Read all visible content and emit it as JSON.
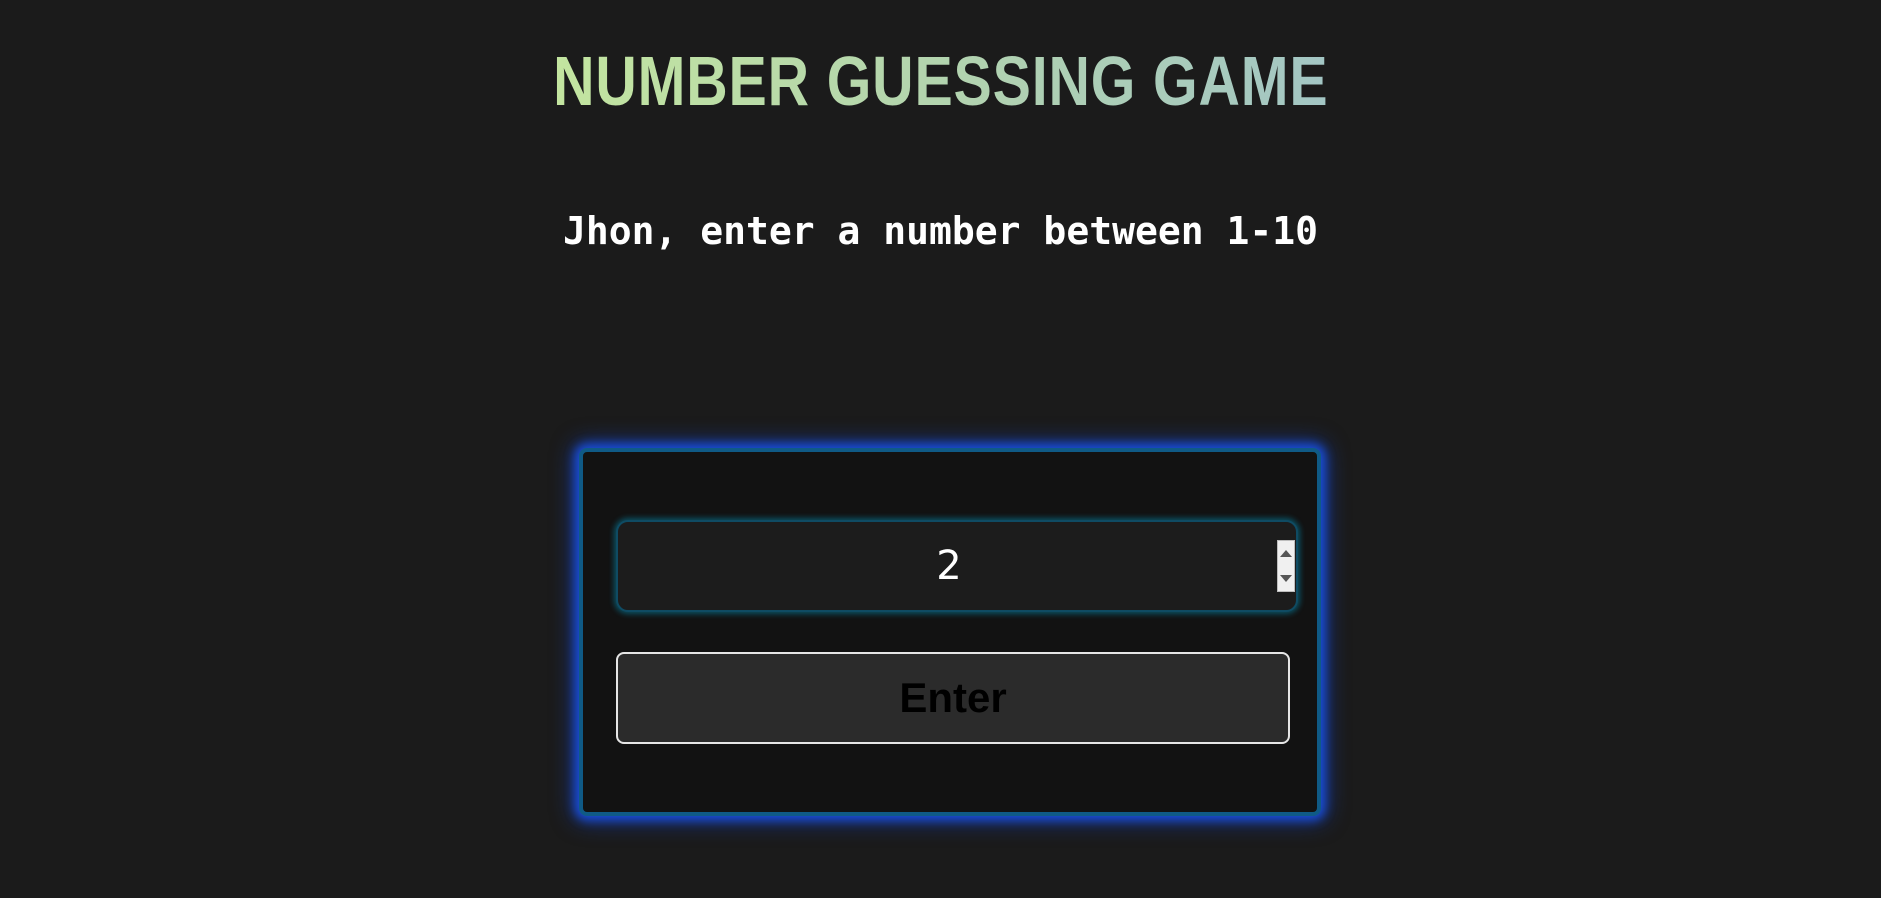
{
  "header": {
    "title": "NUMBER GUESSING GAME"
  },
  "prompt": {
    "text": "Jhon, enter a number between 1-10"
  },
  "form": {
    "guess_value": "2",
    "submit_label": "Enter"
  },
  "colors": {
    "background": "#1b1b1b",
    "panel": "#121212",
    "panel_glow": "#1a4ed8",
    "title_gradient_start": "#c3e5a0",
    "title_gradient_end": "#a3c6c4"
  },
  "icons": {
    "stepper_up": "chevron-up-icon",
    "stepper_down": "chevron-down-icon"
  }
}
